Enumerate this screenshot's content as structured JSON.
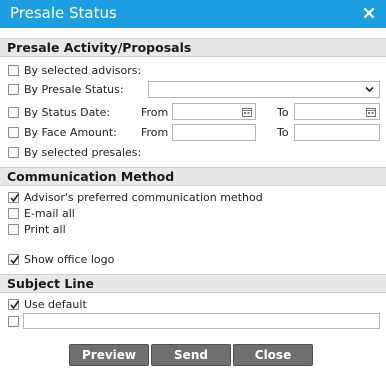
{
  "window": {
    "title": "Presale Status"
  },
  "sections": {
    "activity": "Presale Activity/Proposals",
    "communication": "Communication Method",
    "subject": "Subject Line"
  },
  "activity": {
    "by_advisors": "By selected advisors:",
    "by_status": "By Presale Status:",
    "by_status_date": "By Status Date:",
    "by_face_amount": "By Face Amount:",
    "by_presales": "By selected presales:",
    "from_label": "From",
    "to_label": "To",
    "status_value": "",
    "date_from": "",
    "date_to": "",
    "amount_from": "",
    "amount_to": ""
  },
  "communication": {
    "preferred": "Advisor's preferred communication method",
    "email_all": "E-mail all",
    "print_all": "Print all",
    "show_logo": "Show office logo",
    "checked": {
      "preferred": true,
      "email_all": false,
      "print_all": false,
      "show_logo": true
    }
  },
  "subject": {
    "use_default": "Use default",
    "custom_value": "",
    "checked": {
      "use_default": true,
      "custom": false
    }
  },
  "buttons": {
    "preview": "Preview",
    "send": "Send",
    "close": "Close"
  },
  "colors": {
    "titlebar": "#1e9ee0",
    "button": "#6f6f6f",
    "section": "#e8e8e8"
  }
}
